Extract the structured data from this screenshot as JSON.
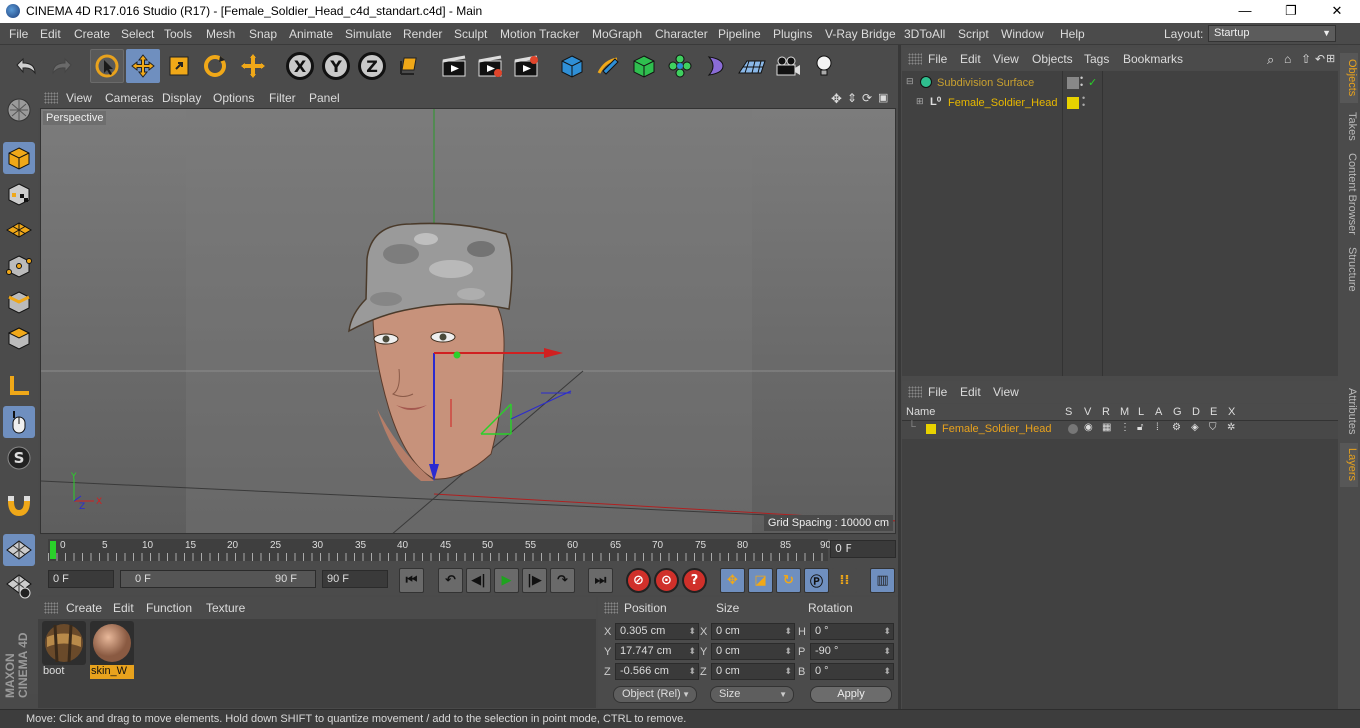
{
  "window": {
    "title": "CINEMA 4D R17.016 Studio (R17) - [Female_Soldier_Head_c4d_standart.c4d] - Main",
    "minimize": "—",
    "maximize": "❐",
    "close": "✕"
  },
  "menubar": {
    "items": [
      "File",
      "Edit",
      "Create",
      "Select",
      "Tools",
      "Mesh",
      "Snap",
      "Animate",
      "Simulate",
      "Render",
      "Sculpt",
      "Motion Tracker",
      "MoGraph",
      "Character",
      "Pipeline",
      "Plugins",
      "V-Ray Bridge",
      "3DToAll",
      "Script",
      "Window",
      "Help"
    ],
    "layout_label": "Layout:",
    "layout_value": "Startup"
  },
  "toolbar": {
    "icons": [
      "undo-icon",
      "redo-icon",
      "live-selection-icon",
      "move-icon",
      "scale-icon",
      "rotate-icon",
      "recent-tools-icon",
      "x-axis-lock-icon",
      "y-axis-lock-icon",
      "z-axis-lock-icon",
      "coordinate-system-icon",
      "render-view-icon",
      "render-picture-viewer-icon",
      "edit-render-settings-icon",
      "cube-icon",
      "pen-icon",
      "subdivision-icon",
      "cloner-icon",
      "deformer-icon",
      "floor-icon",
      "camera-icon",
      "light-icon"
    ],
    "axis_x": "X",
    "axis_y": "Y",
    "axis_z": "Z"
  },
  "viewport": {
    "menu": [
      "View",
      "Cameras",
      "Display",
      "Options",
      "Filter",
      "Panel"
    ],
    "label": "Perspective",
    "grid_spacing": "Grid Spacing : 10000 cm"
  },
  "timeline": {
    "ticks": [
      "0",
      "5",
      "10",
      "15",
      "20",
      "25",
      "30",
      "35",
      "40",
      "45",
      "50",
      "55",
      "60",
      "65",
      "70",
      "75",
      "80",
      "85",
      "90"
    ],
    "current_frame": "0 F"
  },
  "transport": {
    "start_frame": "0 F",
    "range_start": "0 F",
    "range_end": "90 F",
    "end_frame": "90 F"
  },
  "materials": {
    "menu": [
      "Create",
      "Edit",
      "Function",
      "Texture"
    ],
    "items": [
      {
        "name": "boot",
        "selected": false
      },
      {
        "name": "skin_W",
        "selected": true
      }
    ]
  },
  "coordinates": {
    "headers": {
      "position": "Position",
      "size": "Size",
      "rotation": "Rotation"
    },
    "rows": [
      {
        "pl": "X",
        "pv": "0.305 cm",
        "sl": "X",
        "sv": "0 cm",
        "rl": "H",
        "rv": "0 °"
      },
      {
        "pl": "Y",
        "pv": "17.747 cm",
        "sl": "Y",
        "sv": "0 cm",
        "rl": "P",
        "rv": "-90 °"
      },
      {
        "pl": "Z",
        "pv": "-0.566 cm",
        "sl": "Z",
        "sv": "0 cm",
        "rl": "B",
        "rv": "0 °"
      }
    ],
    "mode": "Object (Rel)",
    "size_mode": "Size",
    "apply": "Apply"
  },
  "objects": {
    "menu": [
      "File",
      "Edit",
      "View",
      "Objects",
      "Tags",
      "Bookmarks"
    ],
    "tree": [
      {
        "name": "Subdivision Surface",
        "color": "#c8a030"
      },
      {
        "name": "Female_Soldier_Head",
        "color": "#e8b800"
      }
    ]
  },
  "layers": {
    "menu": [
      "File",
      "Edit",
      "View"
    ],
    "columns": [
      "Name",
      "S",
      "V",
      "R",
      "M",
      "L",
      "A",
      "G",
      "D",
      "E",
      "X"
    ],
    "rows": [
      {
        "name": "Female_Soldier_Head",
        "color": "#e8d200"
      }
    ]
  },
  "side_tabs": [
    "Objects",
    "Takes",
    "Content Browser",
    "Structure",
    "Attributes",
    "Layers"
  ],
  "brand": "MAXON CINEMA 4D",
  "status": "Move: Click and drag to move elements. Hold down SHIFT to quantize movement / add to the selection in point mode, CTRL to remove.",
  "colors": {
    "accent": "#6f8fbf",
    "highlight": "#e8a21d",
    "background": "#4b4b4b"
  }
}
